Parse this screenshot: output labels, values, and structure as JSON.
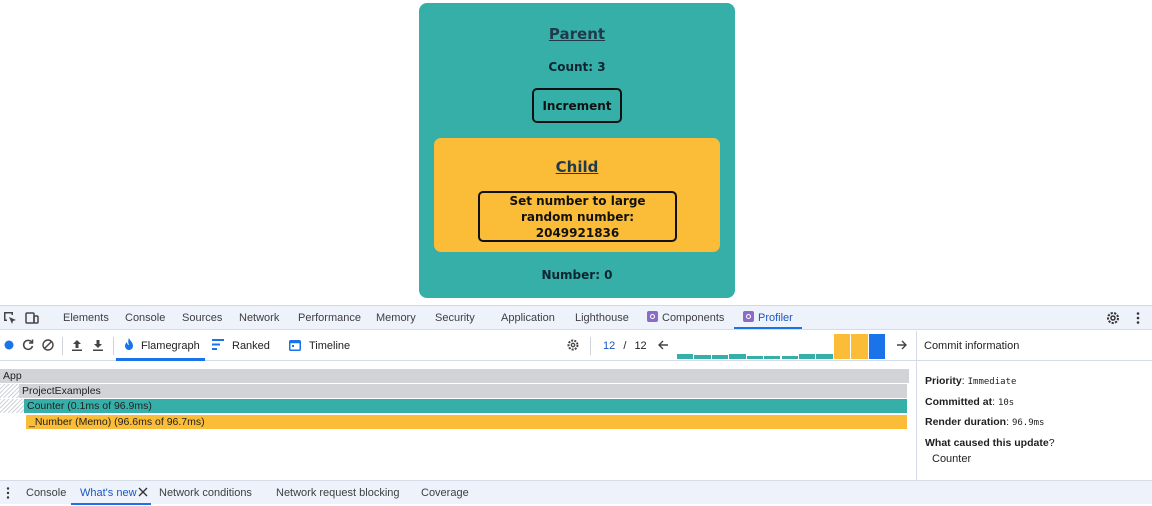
{
  "app": {
    "parent_title": "Parent",
    "count_text": "Count: 3",
    "increment_label": "Increment",
    "child_title": "Child",
    "set_number_label": "Set number to large random number: 2049921836",
    "number_text": "Number: 0",
    "colors": {
      "parent_bg": "#37afa9",
      "child_bg": "#fbbc38"
    }
  },
  "devtools": {
    "main_tabs": [
      "Elements",
      "Console",
      "Sources",
      "Network",
      "Performance",
      "Memory",
      "Security",
      "Application",
      "Lighthouse",
      "Components",
      "Profiler"
    ],
    "active_main_tab": "Profiler",
    "toolbar_icons": [
      "inspect-element-icon",
      "device-toolbar-icon",
      "settings-gear-icon",
      "more-vertical-icon"
    ],
    "profiler": {
      "views": [
        {
          "label": "Flamegraph",
          "icon": "flame-icon",
          "active": true
        },
        {
          "label": "Ranked",
          "icon": "ranked-bars-icon",
          "active": false
        },
        {
          "label": "Timeline",
          "icon": "calendar-icon",
          "active": false
        }
      ],
      "commit_current": "12",
      "commit_separator": "/",
      "commit_total": "12",
      "commit_bars": [
        {
          "level": 0.2,
          "color": "#37afa9"
        },
        {
          "level": 0.15,
          "color": "#37afa9"
        },
        {
          "level": 0.15,
          "color": "#37afa9"
        },
        {
          "level": 0.2,
          "color": "#37afa9"
        },
        {
          "level": 0.1,
          "color": "#37afa9"
        },
        {
          "level": 0.1,
          "color": "#37afa9"
        },
        {
          "level": 0.1,
          "color": "#37afa9"
        },
        {
          "level": 0.2,
          "color": "#37afa9"
        },
        {
          "level": 0.2,
          "color": "#37afa9"
        },
        {
          "level": 1.0,
          "color": "#fbbc38"
        },
        {
          "level": 1.0,
          "color": "#fbbc38"
        },
        {
          "level": 1.0,
          "color": "#1a73e8"
        }
      ],
      "flame_rows": [
        {
          "label": "App",
          "color": "#d1d3d6"
        },
        {
          "label": "ProjectExamples",
          "color": "#d1d3d6"
        },
        {
          "label": "Counter (0.1ms of 96.9ms)",
          "color": "#37afa9"
        },
        {
          "label": "_Number (Memo) (96.6ms of 96.7ms)",
          "color": "#fbbc38"
        }
      ]
    },
    "commit_info": {
      "title": "Commit information",
      "priority_label": "Priority",
      "priority_value": "Immediate",
      "committed_label": "Committed at",
      "committed_value": "10s",
      "render_label": "Render duration",
      "render_value": "96.9ms",
      "cause_label": "What caused this update",
      "cause_value": "Counter"
    },
    "drawer_tabs": [
      "Console",
      "What's new",
      "Network conditions",
      "Network request blocking",
      "Coverage"
    ],
    "active_drawer_tab": "What's new"
  }
}
